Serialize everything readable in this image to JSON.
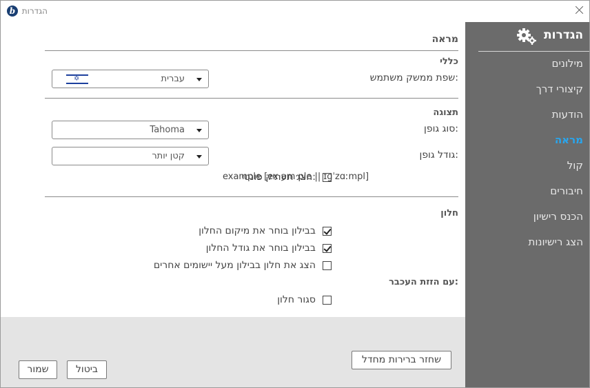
{
  "window": {
    "title": "הגדרות",
    "logo_letter": "b"
  },
  "sidebar": {
    "title": "הגדרות",
    "items": [
      {
        "label": "מילונים"
      },
      {
        "label": "קיצורי דרך"
      },
      {
        "label": "הודעות"
      },
      {
        "label": "מראה",
        "active": true
      },
      {
        "label": "קול"
      },
      {
        "label": "חיבורים"
      },
      {
        "label": "הכנס רישיון"
      },
      {
        "label": "הצג רישיונות"
      }
    ],
    "active_color": "#29a6ee",
    "background": "#6b6b6b"
  },
  "main": {
    "page_title": "מראה",
    "general": {
      "heading": "כללי",
      "ui_language_label": "שפת ממשק משתמש:",
      "ui_language_value": "עברית",
      "ui_language_flag": "israel-flag-icon"
    },
    "display": {
      "heading": "תצוגה",
      "font_type_label": "סוג גופן:",
      "font_type_value": "Tahoma",
      "font_size_label": "גודל גופן:",
      "font_size_value": "קטן יותר",
      "phonetic_label": "הצג תעתיק פונטי:",
      "phonetic_example": "example [ex·am·ple || ɪɡˈzɑːmpl]",
      "phonetic_checked": false
    },
    "window": {
      "heading": "חלון",
      "options": [
        {
          "label": "בבילון בוחר את מיקום החלון",
          "checked": true
        },
        {
          "label": "בבילון בוחר את גודל החלון",
          "checked": true
        },
        {
          "label": "הצג את חלון בבילון מעל יישומים אחרים",
          "checked": false
        }
      ],
      "mouse_move_heading": "עם הזזת העכבר:",
      "close_window_label": "סגור חלון",
      "close_window_checked": false
    }
  },
  "footer": {
    "restore_defaults": "שחזר ברירות מחדל",
    "cancel": "ביטול",
    "save": "שמור"
  }
}
